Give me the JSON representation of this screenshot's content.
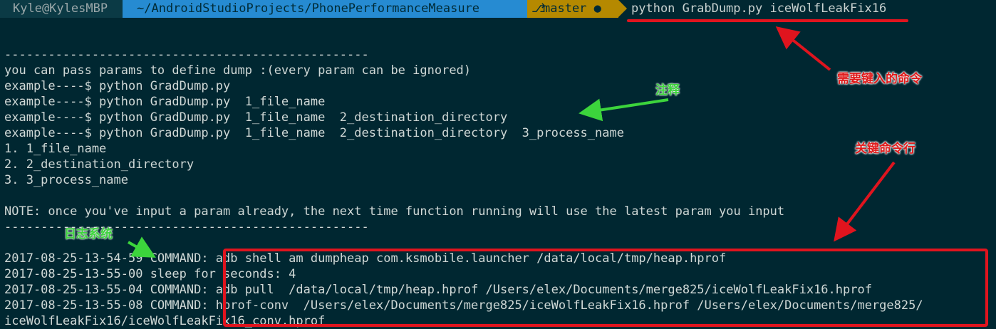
{
  "prompt": {
    "user_host": "Kyle@KylesMBP",
    "path": "~/AndroidStudioProjects/PhonePerformanceMeasure",
    "branch": "master ●",
    "command": "python GrabDump.py iceWolfLeakFix16"
  },
  "terminal": {
    "lines": [
      "--------------------------------------------------",
      "you can pass params to define dump :(every param can be ignored)",
      "example----$ python GradDump.py",
      "example----$ python GradDump.py  1_file_name",
      "example----$ python GradDump.py  1_file_name  2_destination_directory",
      "example----$ python GradDump.py  1_file_name  2_destination_directory  3_process_name",
      "1. 1_file_name",
      "2. 2_destination_directory",
      "3. 3_process_name",
      "",
      "NOTE: once you've input a param already, the next time function running will use the latest param you input",
      "--------------------------------------------------",
      "",
      "2017-08-25-13-54-59 COMMAND: adb shell am dumpheap com.ksmobile.launcher /data/local/tmp/heap.hprof",
      "2017-08-25-13-55-00 sleep for seconds: 4",
      "2017-08-25-13-55-04 COMMAND: adb pull  /data/local/tmp/heap.hprof /Users/elex/Documents/merge825/iceWolfLeakFix16.hprof",
      "2017-08-25-13-55-08 COMMAND: hprof-conv  /Users/elex/Documents/merge825/iceWolfLeakFix16.hprof /Users/elex/Documents/merge825/",
      "iceWolfLeakFix16/iceWolfLeakFix16_conv.hprof"
    ]
  },
  "annotations": {
    "command_note": "需要键入的命令",
    "comment_note": "注释",
    "key_lines_note": "关键命令行",
    "log_note": "日志系统"
  },
  "colors": {
    "background": "#002731",
    "path_segment": "#268bd2",
    "git_segment": "#b58900",
    "annotation_red": "#e0141e",
    "annotation_green": "#3cd43c"
  }
}
